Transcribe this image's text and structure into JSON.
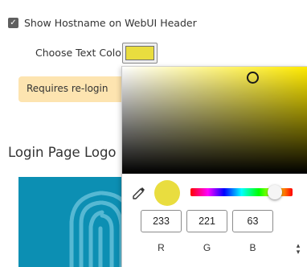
{
  "settings": {
    "show_hostname_label": "Show Hostname on WebUI Header",
    "show_hostname_checked": true,
    "text_color_label": "Choose Text Color",
    "relogin_notice": "Requires re-login",
    "login_logo_heading": "Login Page Logo Im"
  },
  "color_picker": {
    "selected_color": "#e9dd3f",
    "hue_color": "#ffea00",
    "hue_level": 0.83,
    "channels": [
      {
        "label": "R",
        "value": "233"
      },
      {
        "label": "G",
        "value": "221"
      },
      {
        "label": "B",
        "value": "63"
      }
    ],
    "eyedropper_icon": "eyedropper-icon",
    "mode_toggle_icon": "swap-vertical-icon"
  },
  "colors": {
    "banner_bg": "#fde4b0",
    "logo_bg": "#0c8fb3",
    "checkbox_fill": "#5f5f5f"
  }
}
